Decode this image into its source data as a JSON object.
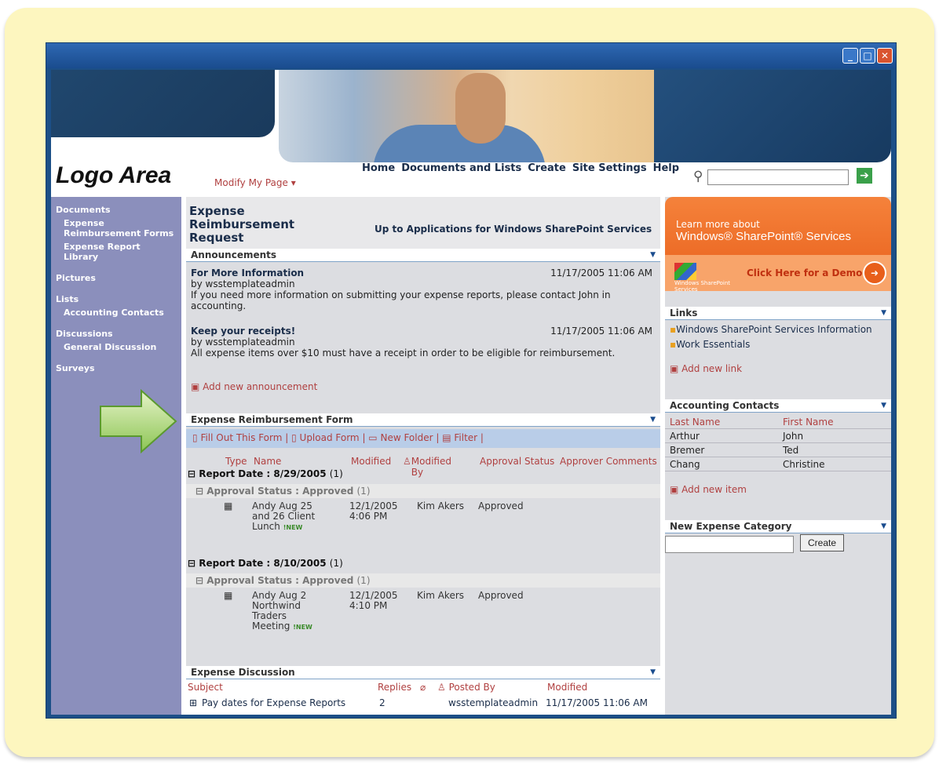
{
  "window": {
    "min": "_",
    "max": "□",
    "close": "✕"
  },
  "header": {
    "logo": "Logo Area",
    "modify": "Modify My Page ▾",
    "nav": [
      "Home",
      "Documents and Lists",
      "Create",
      "Site Settings",
      "Help"
    ],
    "search_placeholder": "",
    "go": "➔"
  },
  "sidebar": {
    "documents": "Documents",
    "doc_items": [
      "Expense Reimbursement Forms",
      "Expense Report Library"
    ],
    "pictures": "Pictures",
    "lists": "Lists",
    "list_items": [
      "Accounting Contacts"
    ],
    "discussions": "Discussions",
    "discussion_items": [
      "General Discussion"
    ],
    "surveys": "Surveys"
  },
  "main": {
    "title": "Expense Reimbursement Request",
    "upto": "Up to Applications for Windows SharePoint Services",
    "announcements": {
      "header": "Announcements",
      "items": [
        {
          "title": "For More Information",
          "by": "by wsstemplateadmin",
          "date": "11/17/2005 11:06 AM",
          "body": "If you need more information on submitting your expense reports, please contact John in accounting."
        },
        {
          "title": "Keep your receipts!",
          "by": "by wsstemplateadmin",
          "date": "11/17/2005 11:06 AM",
          "body": "All expense items over $10 must have a receipt in order to be eligible for reimbursement."
        }
      ],
      "add": "Add new announcement"
    },
    "form": {
      "header": "Expense Reimbursement Form",
      "toolbar": [
        "Fill Out This Form",
        "Upload Form",
        "New Folder",
        "Filter"
      ],
      "columns": [
        "Type",
        "Name",
        "Modified",
        "Modified By",
        "Approval Status",
        "Approver Comments"
      ],
      "groups": [
        {
          "label": "Report Date : 8/29/2005",
          "count": "(1)",
          "sub": "Approval Status : Approved",
          "subcount": "(1)",
          "name_lines": [
            "Andy Aug 25",
            "and 26 Client",
            "Lunch"
          ],
          "modified": [
            "12/1/2005",
            "4:06 PM"
          ],
          "by": "Kim Akers",
          "status": "Approved"
        },
        {
          "label": "Report Date : 8/10/2005",
          "count": "(1)",
          "sub": "Approval Status : Approved",
          "subcount": "(1)",
          "name_lines": [
            "Andy Aug 2",
            "Northwind",
            "Traders",
            "Meeting"
          ],
          "modified": [
            "12/1/2005",
            "4:10 PM"
          ],
          "by": "Kim Akers",
          "status": "Approved"
        }
      ],
      "new_tag": "NEW"
    },
    "discussion": {
      "header": "Expense Discussion",
      "columns": [
        "Subject",
        "Replies",
        "Posted By",
        "Modified"
      ],
      "row": {
        "subject": "Pay dates for Expense Reports",
        "replies": "2",
        "by": "wsstemplateadmin",
        "modified": "11/17/2005 11:06 AM"
      }
    }
  },
  "right": {
    "promo": {
      "line1": "Learn more about",
      "line2": "Windows® SharePoint® Services",
      "logo_text": "Windows SharePoint Services",
      "demo": "Click Here for a Demo"
    },
    "links": {
      "header": "Links",
      "items": [
        "Windows SharePoint Services Information",
        "Work Essentials"
      ],
      "add": "Add new link"
    },
    "contacts": {
      "header": "Accounting Contacts",
      "cols": [
        "Last Name",
        "First Name"
      ],
      "rows": [
        [
          "Arthur",
          "John"
        ],
        [
          "Bremer",
          "Ted"
        ],
        [
          "Chang",
          "Christine"
        ]
      ],
      "add": "Add new item"
    },
    "newcat": {
      "header": "New Expense Category",
      "button": "Create"
    }
  },
  "colors": {
    "nav_purple": "#8b8fbc",
    "accent_red": "#b04040",
    "frame_yellow": "#fdf6bf",
    "promo_orange": "#e85f1b"
  }
}
